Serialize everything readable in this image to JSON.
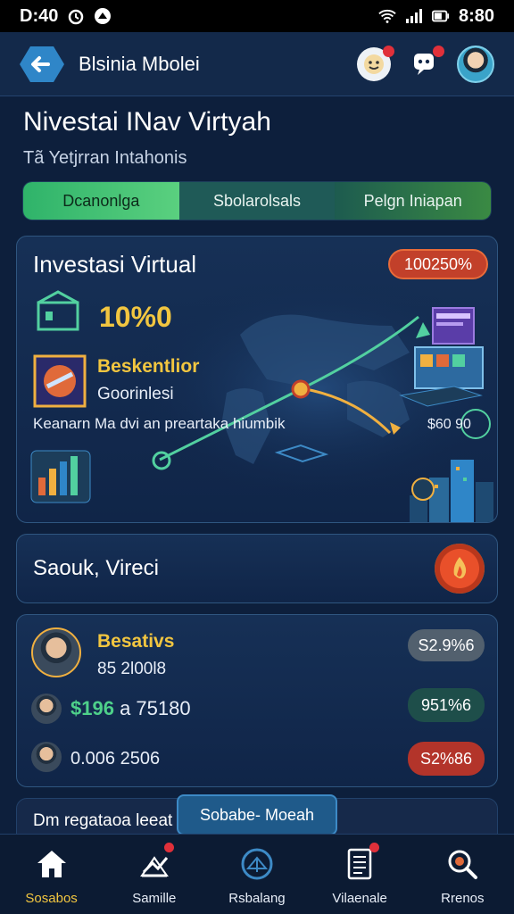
{
  "status_bar": {
    "time_left": "D:40",
    "time_right": "8:80"
  },
  "app_bar": {
    "title": "Blsinia Mbolei"
  },
  "page": {
    "title": "Nivestai INav Virtyah",
    "subtitle": "Tã Yetjrran Intahonis"
  },
  "tabs": [
    {
      "label": "Dcanonlga"
    },
    {
      "label": "Sbolarolsals"
    },
    {
      "label": "Pelgn Iniapan"
    }
  ],
  "hero": {
    "title": "Investasi Virtual",
    "badge": "100250%",
    "percent": "10%0",
    "brand": "Beskentlior",
    "brand_sub": "Goorinlesi",
    "caption": "Keanarn Ma dvi an preartaka hiumbik",
    "value": "$60 90"
  },
  "search": {
    "text": "Saouk, Vireci"
  },
  "list": {
    "row1": {
      "name": "Besativs",
      "sub": "85 2l00l8",
      "pill": "S2.9%6"
    },
    "row2": {
      "amount": "$196",
      "text": "a 75180",
      "pill": "951%6"
    },
    "row3": {
      "text": "0.006 2506",
      "pill": "S2%86"
    }
  },
  "bottom": {
    "strip_text": "Dm regataoa leeat",
    "float_button": "Sobabe- Moeah"
  },
  "nav": [
    {
      "label": "Sosabos"
    },
    {
      "label": "Samille"
    },
    {
      "label": "Rsbalang"
    },
    {
      "label": "Vilaenale"
    },
    {
      "label": "Rrenos"
    }
  ],
  "colors": {
    "accent": "#f2c640",
    "green": "#4ed08a",
    "red": "#c2402a",
    "bg": "#0d1f3c"
  }
}
